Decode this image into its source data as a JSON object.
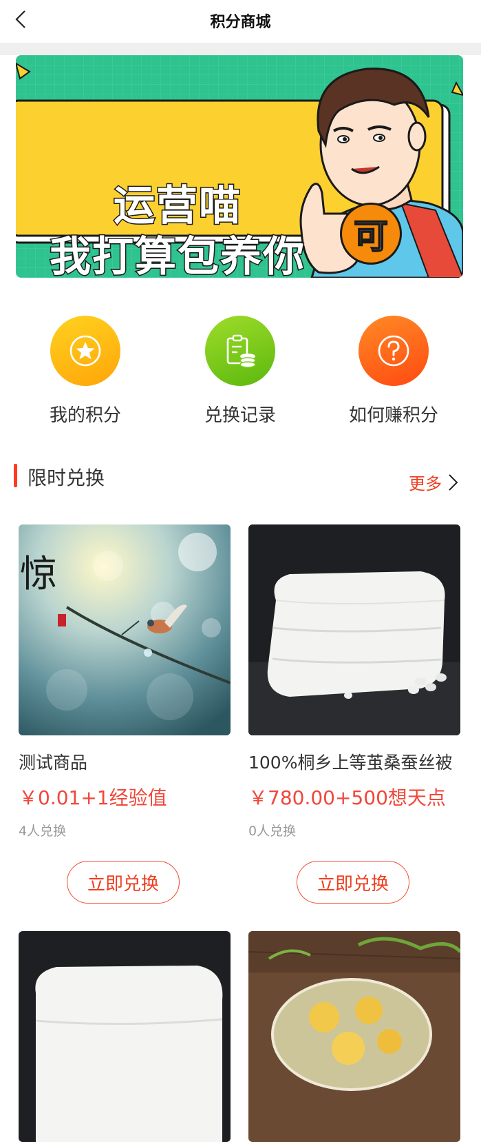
{
  "header": {
    "title": "积分商城",
    "back_icon": "chevron-left-icon"
  },
  "banner": {
    "line1": "运营喵",
    "line2": "我打算包养你",
    "badge": "可"
  },
  "entries": [
    {
      "label": "我的积分",
      "icon": "star-icon",
      "color": "#ffb814"
    },
    {
      "label": "兑换记录",
      "icon": "record-coins-icon",
      "color": "#7ccb1b"
    },
    {
      "label": "如何赚积分",
      "icon": "question-icon",
      "color": "#ff6318"
    }
  ],
  "section": {
    "title": "限时兑换",
    "more": "更多"
  },
  "products": [
    {
      "name": "测试商品",
      "price": "￥0.01+1经验值",
      "count": "4人兑换",
      "button": "立即兑换"
    },
    {
      "name": "100%桐乡上等茧桑蚕丝被",
      "price": "￥780.00+500想天点",
      "count": "0人兑换",
      "button": "立即兑换"
    },
    {
      "name": "",
      "price": "",
      "count": "",
      "button": ""
    },
    {
      "name": "",
      "price": "",
      "count": "",
      "button": ""
    }
  ],
  "colors": {
    "accent": "#f03d1e",
    "banner_green": "#2ec38f",
    "banner_yellow": "#fcd02f"
  }
}
